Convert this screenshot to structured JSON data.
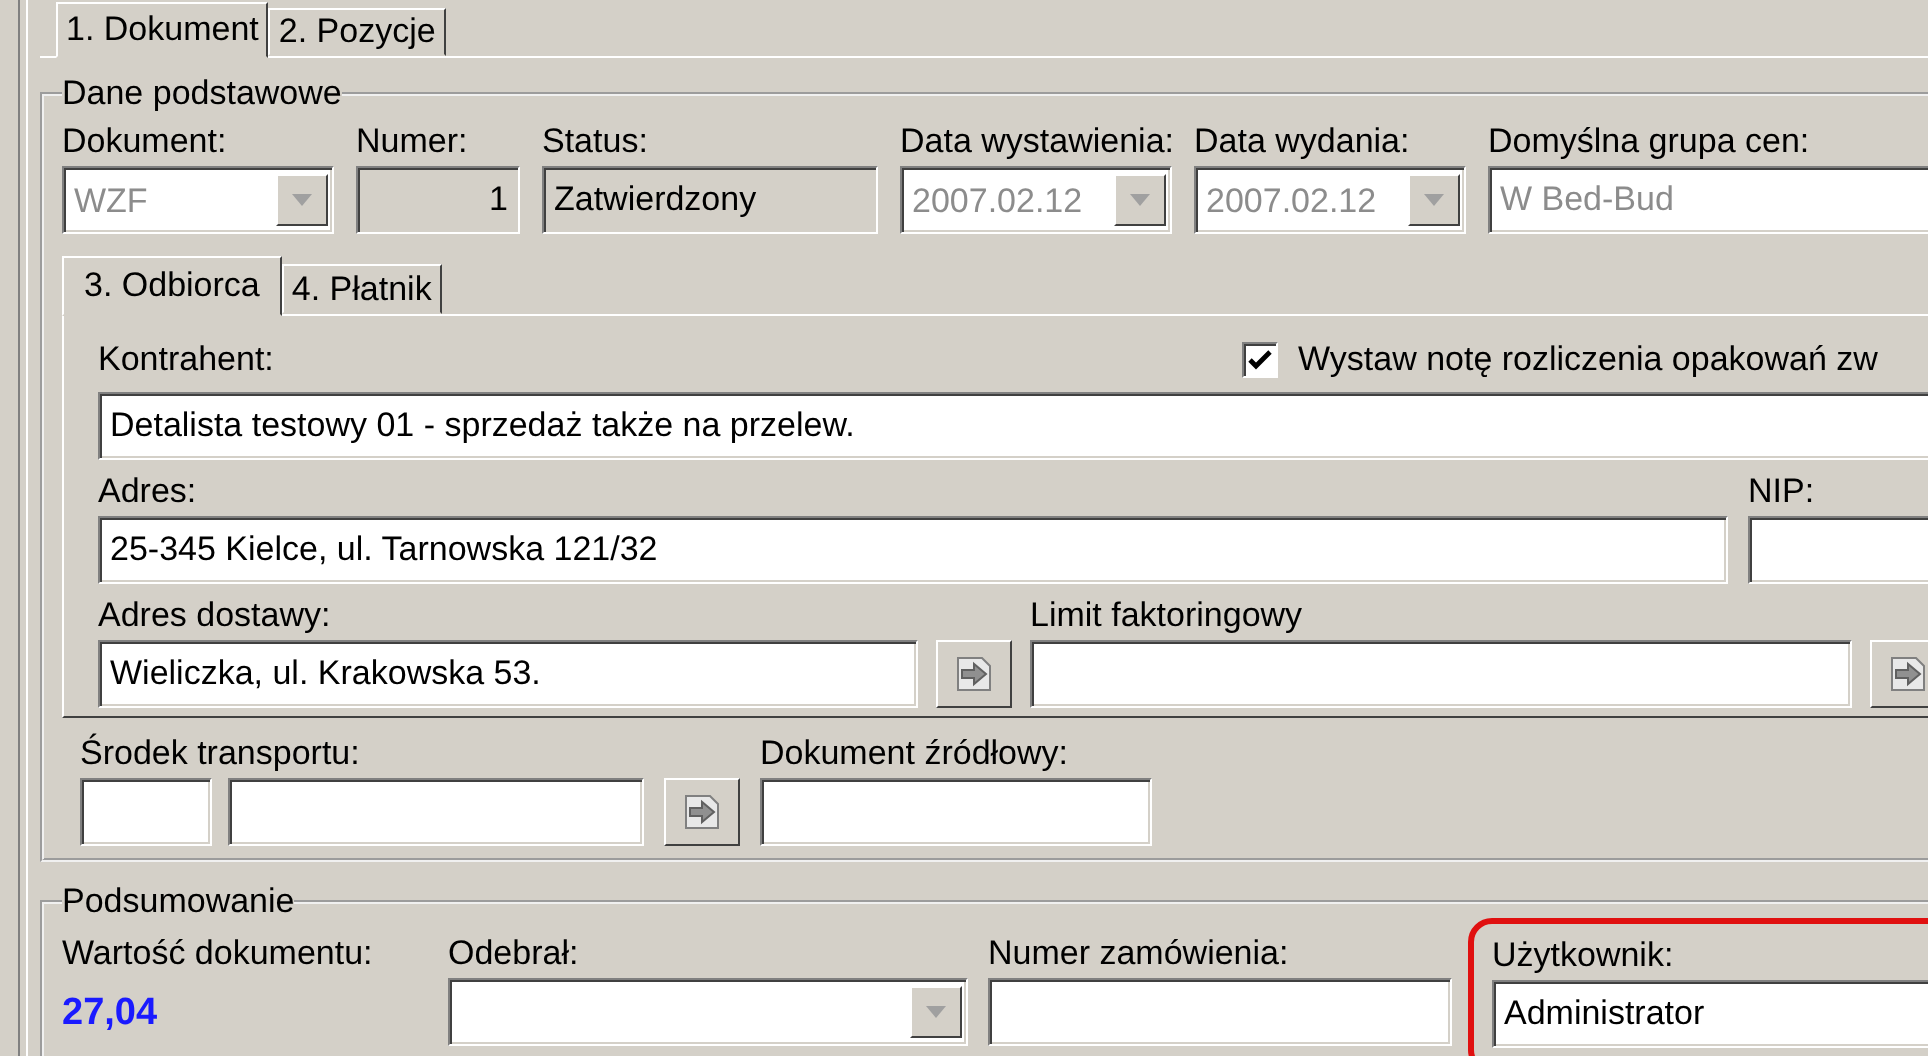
{
  "tabs": [
    {
      "label": "1. Dokument",
      "selected": true
    },
    {
      "label": "2. Pozycje",
      "selected": false
    }
  ],
  "basic_group": {
    "title": "Dane podstawowe",
    "fields": [
      {
        "label": "Dokument:",
        "value": "WZF",
        "kind": "combo",
        "disabled": true
      },
      {
        "label": "Numer:",
        "value": "1",
        "kind": "readonly",
        "disabled": false
      },
      {
        "label": "Status:",
        "value": "Zatwierdzony",
        "kind": "readonly",
        "disabled": false
      },
      {
        "label": "Data wystawienia:",
        "value": "2007.02.12",
        "kind": "combo",
        "disabled": true
      },
      {
        "label": "Data wydania:",
        "value": "2007.02.12",
        "kind": "combo",
        "disabled": true
      },
      {
        "label": "Domyślna grupa cen:",
        "value": "W Bed-Bud",
        "kind": "text",
        "disabled": true
      }
    ]
  },
  "sub_tabs": [
    {
      "label": "3. Odbiorca",
      "selected": true
    },
    {
      "label": "4. Płatnik",
      "selected": false
    }
  ],
  "recipient": {
    "contractor": {
      "label": "Kontrahent:",
      "value": "Detalista testowy 01 - sprzedaż także na przelew."
    },
    "packaging_note": {
      "label": "Wystaw notę rozliczenia opakowań zw",
      "checked": true
    },
    "address": {
      "label": "Adres:",
      "value": "25-345 Kielce, ul. Tarnowska 121/32"
    },
    "nip": {
      "label": "NIP:"
    },
    "delivery_address": {
      "label": "Adres dostawy:",
      "value": "Wieliczka, ul. Krakowska 53."
    },
    "factoring_limit": {
      "label": "Limit faktoringowy"
    }
  },
  "transport": {
    "label": "Środek transportu:"
  },
  "source_document": {
    "label": "Dokument źródłowy:"
  },
  "summary": {
    "title": "Podsumowanie",
    "document_value": {
      "label": "Wartość dokumentu:",
      "value": "27,04"
    },
    "received_by": {
      "label": "Odebrał:"
    },
    "order_number": {
      "label": "Numer zamówienia:"
    },
    "user": {
      "label": "Użytkownik:",
      "value": "Administrator",
      "highlighted": true
    }
  }
}
